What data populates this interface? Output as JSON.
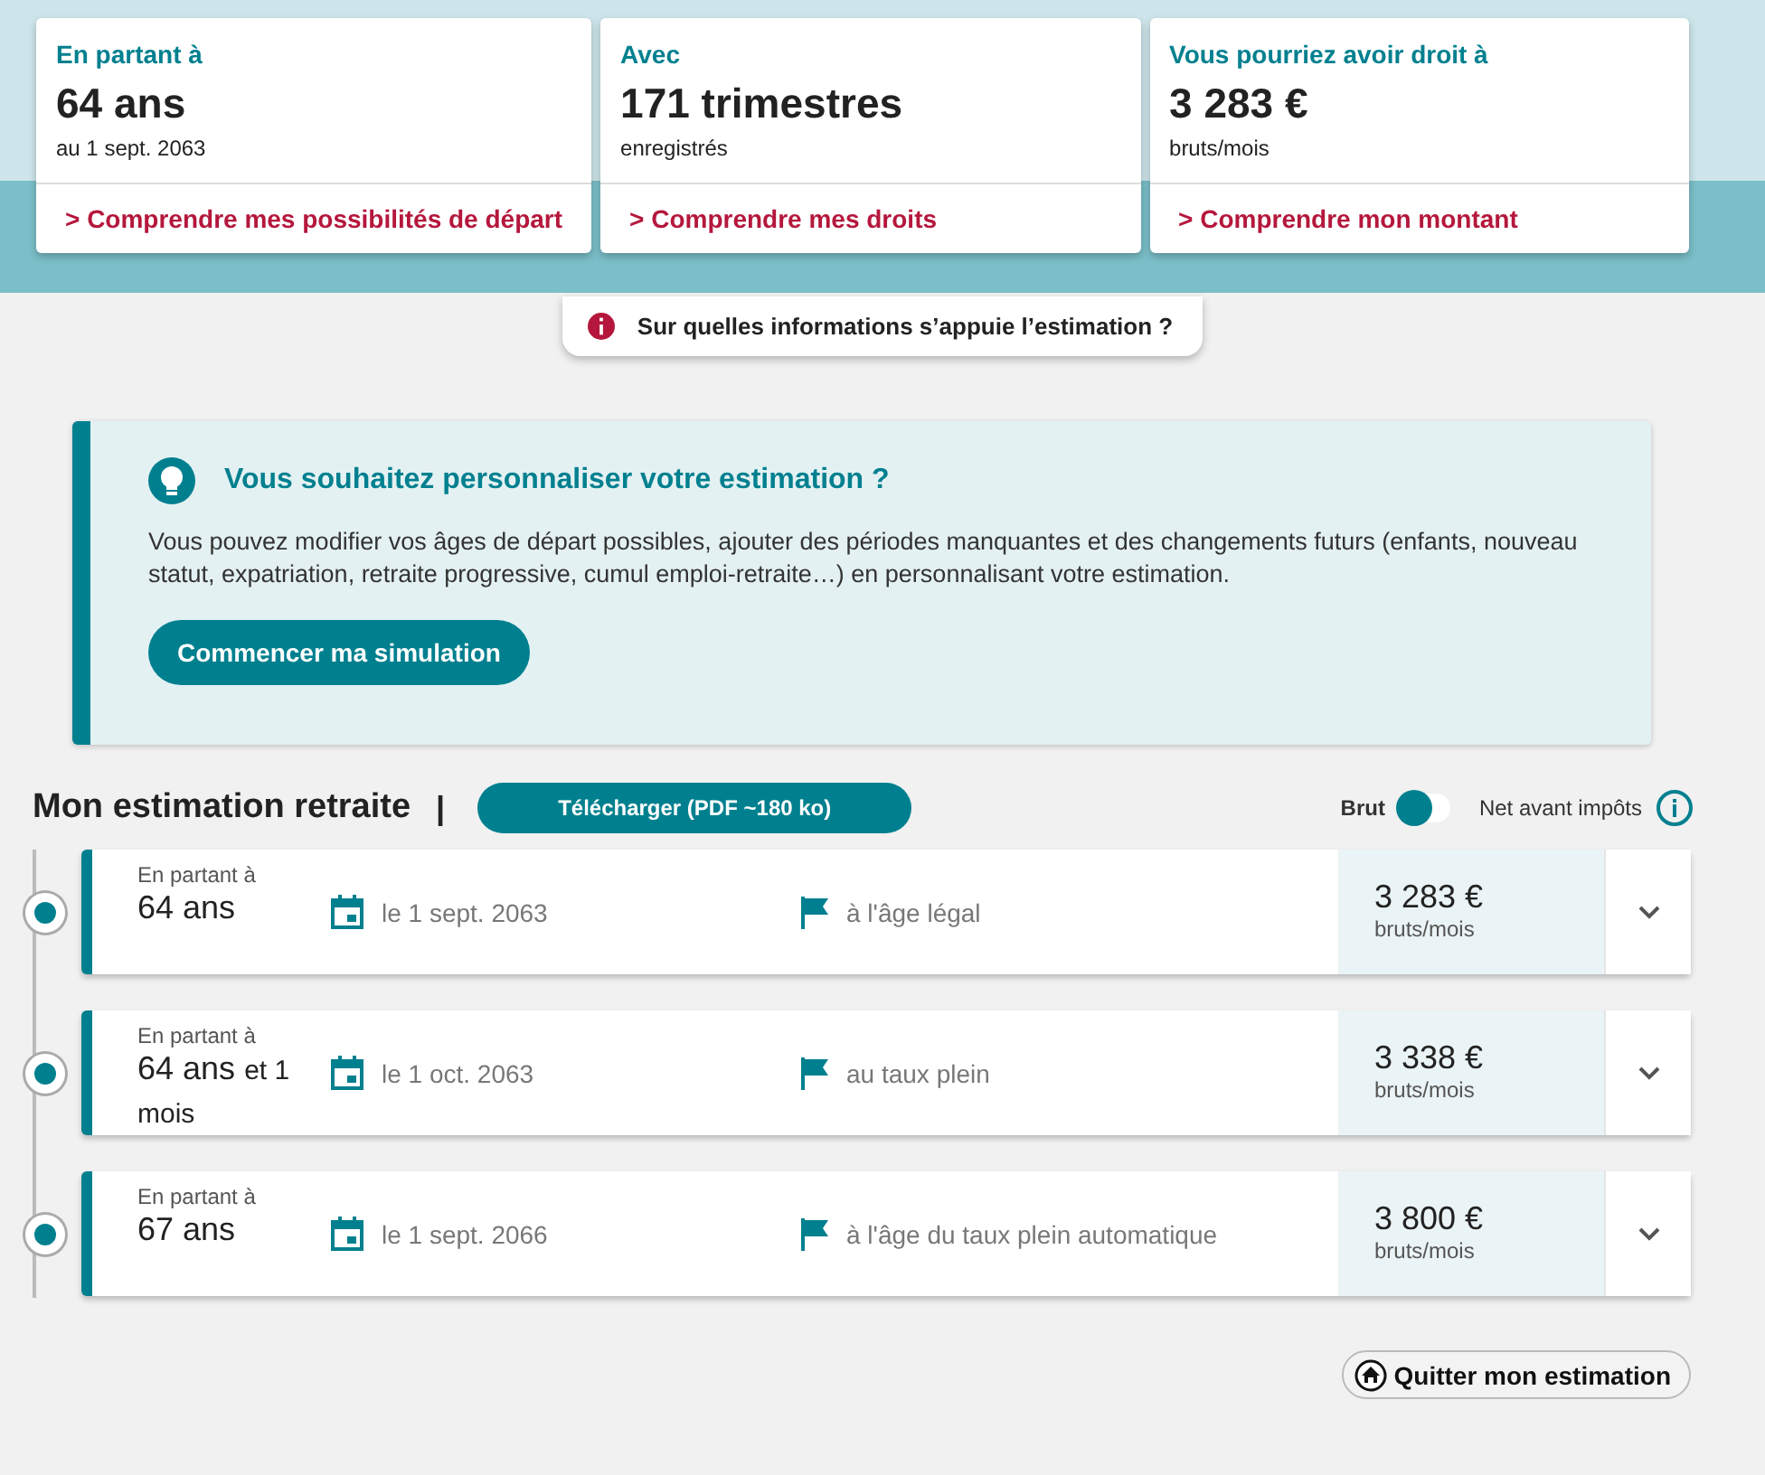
{
  "summary_cards": [
    {
      "label": "En partant à",
      "value": "64 ans",
      "sub": "au 1 sept. 2063",
      "link": "> Comprendre mes possibilités de départ"
    },
    {
      "label": "Avec",
      "value": "171 trimestres",
      "sub": "enregistrés",
      "link": "> Comprendre mes droits"
    },
    {
      "label": "Vous pourriez avoir droit à",
      "value": "3 283 €",
      "sub": "bruts/mois",
      "link": "> Comprendre mon montant"
    }
  ],
  "info_button": "Sur quelles informations s’appuie l’estimation ?",
  "banner": {
    "title": "Vous souhaitez personnaliser votre estimation ?",
    "text": "Vous pouvez modifier vos âges de départ possibles, ajouter des périodes manquantes et des changements futurs (enfants, nouveau statut, expatriation, retraite progressive, cumul emploi-retraite…) en personnalisant votre estimation.",
    "button": "Commencer ma simulation"
  },
  "section": {
    "title": "Mon estimation retraite",
    "separator": "|",
    "download": "Télécharger (PDF ~180 ko)",
    "toggle": {
      "left_label": "Brut",
      "right_label": "Net avant impôts",
      "on": false
    }
  },
  "options": [
    {
      "caption": "En partant à",
      "age": "64 ans",
      "date": "le 1 sept. 2063",
      "condition": "à l'âge légal",
      "amount": "3 283 €",
      "unit": "bruts/mois",
      "expanded": false
    },
    {
      "caption": "En partant à",
      "age": "64 ans",
      "age_extra": "et 1 mois",
      "date": "le 1 oct. 2063",
      "condition": "au taux plein",
      "amount": "3 338 €",
      "unit": "bruts/mois",
      "expanded": false
    },
    {
      "caption": "En partant à",
      "age": "67 ans",
      "date": "le 1 sept. 2066",
      "condition": "à l'âge du taux plein automatique",
      "amount": "3 800 €",
      "unit": "bruts/mois",
      "expanded": false
    }
  ],
  "quit_button": "Quitter mon estimation"
}
